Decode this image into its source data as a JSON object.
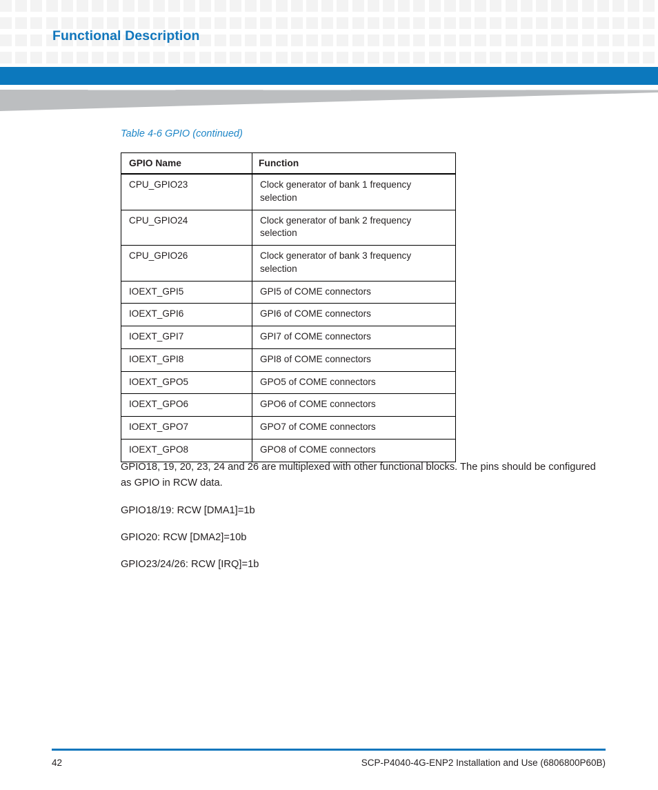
{
  "header": {
    "section_title": "Functional Description"
  },
  "table": {
    "caption": "Table 4-6 GPIO (continued)",
    "columns": [
      "GPIO Name",
      "Function"
    ],
    "rows": [
      {
        "name": "CPU_GPIO23",
        "function": "Clock generator of bank 1 frequency selection",
        "tall": true
      },
      {
        "name": "CPU_GPIO24",
        "function": "Clock generator of bank 2 frequency selection",
        "tall": true
      },
      {
        "name": "CPU_GPIO26",
        "function": "Clock generator of bank 3 frequency selection",
        "tall": true
      },
      {
        "name": "IOEXT_GPI5",
        "function": "GPI5 of COME connectors",
        "tall": false
      },
      {
        "name": "IOEXT_GPI6",
        "function": "GPI6 of COME connectors",
        "tall": false
      },
      {
        "name": "IOEXT_GPI7",
        "function": "GPI7 of COME connectors",
        "tall": false
      },
      {
        "name": "IOEXT_GPI8",
        "function": "GPI8 of COME connectors",
        "tall": false
      },
      {
        "name": "IOEXT_GPO5",
        "function": "GPO5 of COME connectors",
        "tall": false
      },
      {
        "name": "IOEXT_GPO6",
        "function": "GPO6 of COME connectors",
        "tall": false
      },
      {
        "name": "IOEXT_GPO7",
        "function": "GPO7 of COME connectors",
        "tall": false
      },
      {
        "name": "IOEXT_GPO8",
        "function": "GPO8 of COME connectors",
        "tall": false
      }
    ]
  },
  "body": {
    "intro": "GPIO18, 19, 20, 23, 24 and 26 are multiplexed with other functional blocks. The pins should be configured as GPIO in RCW data.",
    "dma1": "GPIO18/19: RCW [DMA1]=1b",
    "dma2": "GPIO20: RCW [DMA2]=10b",
    "irq": "GPIO23/24/26: RCW [IRQ]=1b"
  },
  "footer": {
    "page_number": "42",
    "document_title": "SCP-P4040-4G-ENP2 Installation and Use (6806800P60B)"
  },
  "colors": {
    "accent_blue": "#1076bc",
    "band_blue": "#0c78bd",
    "caption_blue": "#1e86c7",
    "swoosh_gray": "#bcbec0",
    "checker_gray": "#f3f3f3",
    "text": "#231f20"
  }
}
